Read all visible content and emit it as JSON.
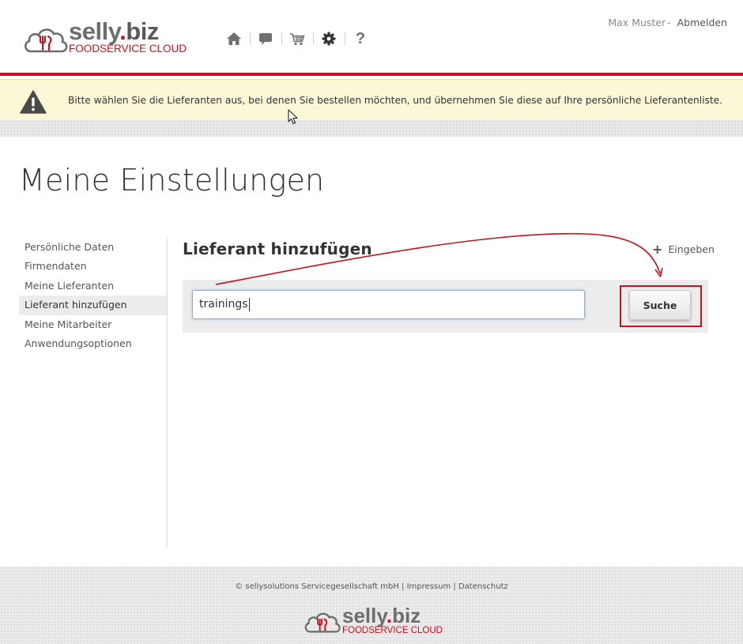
{
  "brand": {
    "name_main": "selly",
    "name_dot": ".",
    "name_ext": "biz",
    "tagline": "FOODSERVICE CLOUD",
    "accent_color": "#c8101e"
  },
  "topnav": {
    "items": [
      {
        "icon": "home-icon"
      },
      {
        "icon": "chat-icon"
      },
      {
        "icon": "cart-icon"
      },
      {
        "icon": "gear-icon"
      },
      {
        "icon": "help-icon",
        "glyph": "?"
      }
    ]
  },
  "user": {
    "name": "Max Muster",
    "separator": "-",
    "logout_label": "Abmelden"
  },
  "notice": {
    "message": "Bitte wählen Sie die Lieferanten aus, bei denen Sie bestellen möchten, und übernehmen Sie diese auf Ihre persönliche Lieferantenliste."
  },
  "page": {
    "title": "Meine Einstellungen"
  },
  "sidebar": {
    "items": [
      {
        "label": "Persönliche Daten",
        "active": false
      },
      {
        "label": "Firmendaten",
        "active": false
      },
      {
        "label": "Meine Lieferanten",
        "active": false
      },
      {
        "label": "Lieferant hinzufügen",
        "active": true
      },
      {
        "label": "Meine Mitarbeiter",
        "active": false
      },
      {
        "label": "Anwendungsoptionen",
        "active": false
      }
    ]
  },
  "content": {
    "title": "Lieferant hinzufügen",
    "add_link_plus": "+",
    "add_link_label": "Eingeben",
    "search_value": "trainings",
    "search_button_label": "Suche"
  },
  "footer": {
    "copyright": "© sellysolutions Servicegesellschaft mbH",
    "sep": "|",
    "impressum": "Impressum",
    "datenschutz": "Datenschutz"
  }
}
